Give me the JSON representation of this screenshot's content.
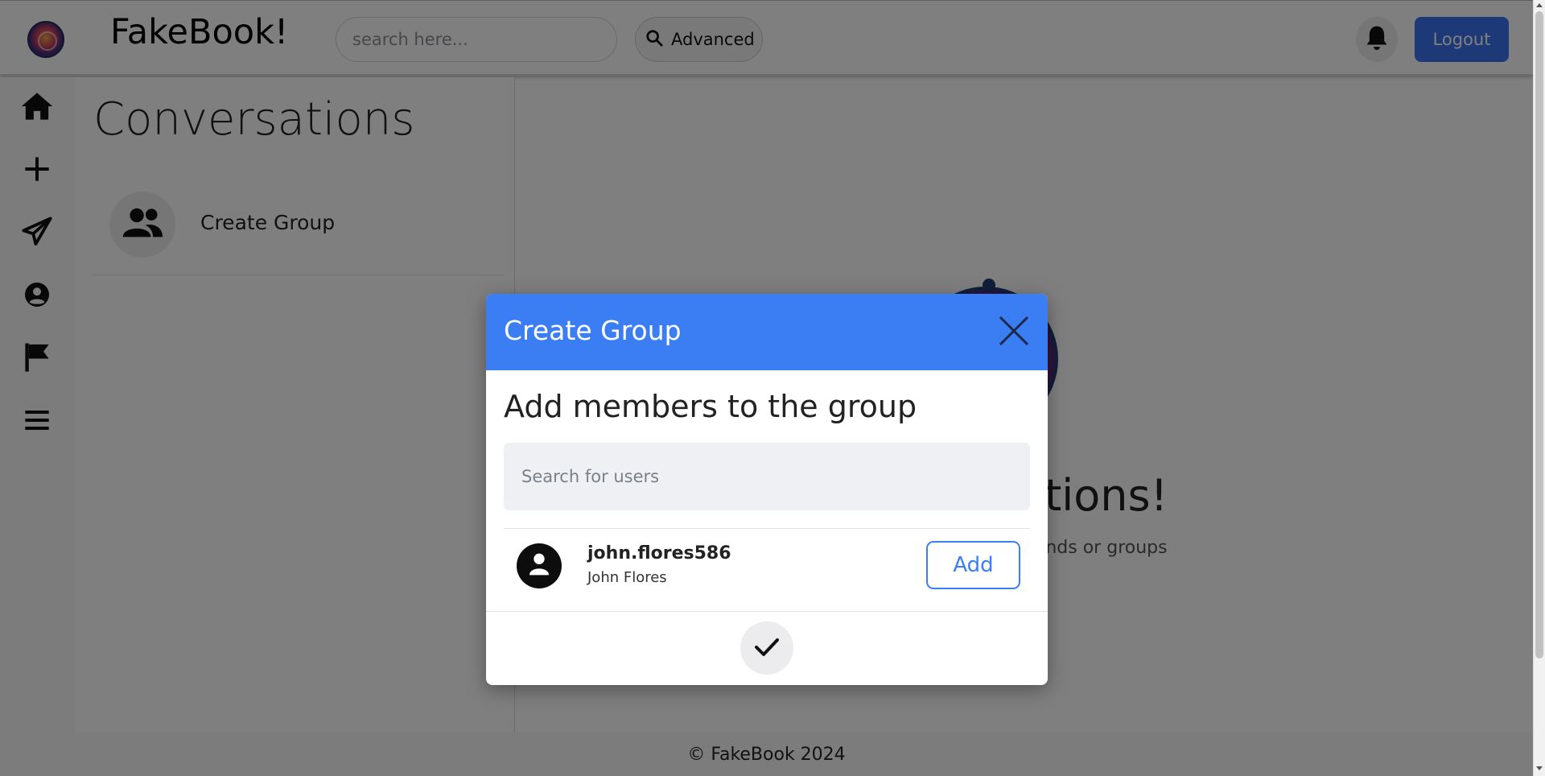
{
  "header": {
    "brand": "FakeBook!",
    "search_placeholder": "search here...",
    "advanced_label": "Advanced",
    "logout_label": "Logout"
  },
  "sidebar": {
    "items": [
      {
        "name": "home",
        "icon": "home-icon"
      },
      {
        "name": "create",
        "icon": "plus-icon"
      },
      {
        "name": "messages",
        "icon": "paper-plane-icon"
      },
      {
        "name": "profile",
        "icon": "user-circle-icon"
      },
      {
        "name": "reports",
        "icon": "flag-icon"
      },
      {
        "name": "menu",
        "icon": "menu-icon"
      }
    ]
  },
  "conversations": {
    "title": "Conversations",
    "items": [
      {
        "label": "Create Group",
        "icon": "users-icon"
      }
    ]
  },
  "main": {
    "heading_visible": "rsations!",
    "subtext_visible": "s to friends or groups"
  },
  "modal": {
    "title": "Create Group",
    "subtitle": "Add members to the group",
    "search_placeholder": "Search for users",
    "users": [
      {
        "handle": "john.flores586",
        "name": "John Flores",
        "action": "Add"
      }
    ]
  },
  "footer": {
    "text": "© FakeBook 2024"
  },
  "colors": {
    "primary": "#3b7ef3",
    "backdrop": "rgba(0,0,0,0.5)"
  }
}
